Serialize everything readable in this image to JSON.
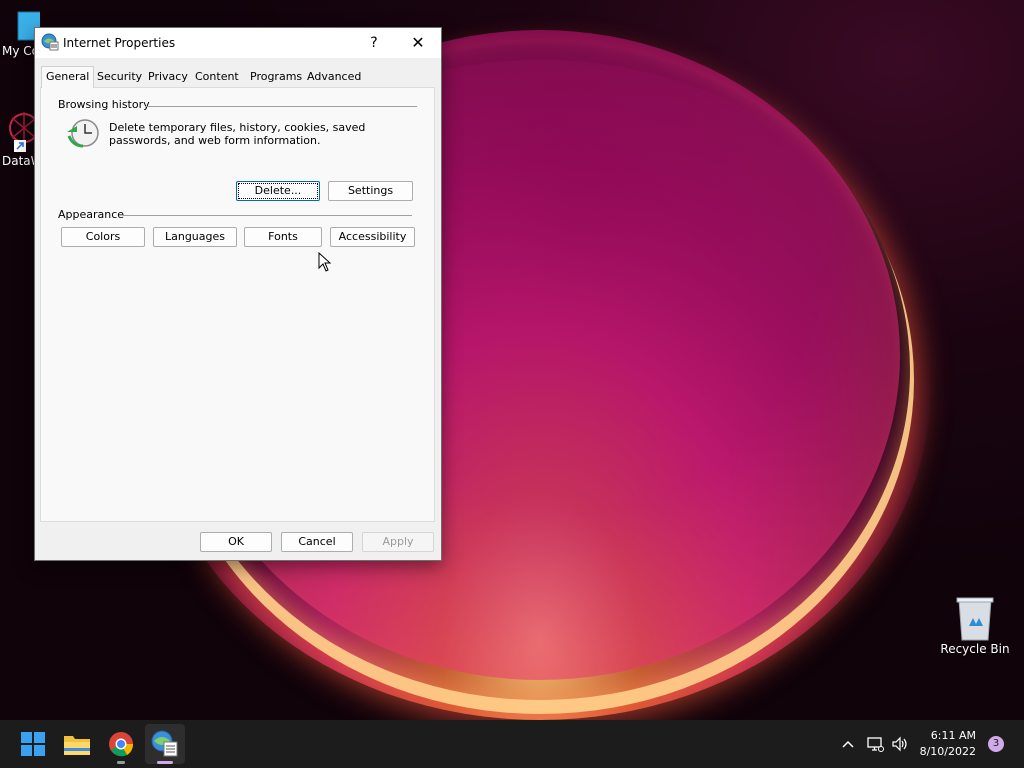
{
  "desktop": {
    "icons": [
      {
        "label": "My Co"
      },
      {
        "label": "DataW"
      },
      {
        "label": "Recycle Bin"
      }
    ]
  },
  "dialog": {
    "title": "Internet Properties",
    "help_label": "?",
    "close_label": "✕",
    "tabs": [
      {
        "label": "General",
        "active": true
      },
      {
        "label": "Security"
      },
      {
        "label": "Privacy"
      },
      {
        "label": "Content"
      },
      {
        "label": "Programs"
      },
      {
        "label": "Advanced"
      }
    ],
    "browsing_history": {
      "heading": "Browsing history",
      "description": "Delete temporary files, history, cookies, saved passwords, and web form information.",
      "delete_label": "Delete...",
      "settings_label": "Settings"
    },
    "appearance": {
      "heading": "Appearance",
      "buttons": [
        {
          "label": "Colors"
        },
        {
          "label": "Languages"
        },
        {
          "label": "Fonts"
        },
        {
          "label": "Accessibility"
        }
      ]
    },
    "footer": {
      "ok_label": "OK",
      "cancel_label": "Cancel",
      "apply_label": "Apply",
      "apply_disabled": true
    }
  },
  "taskbar": {
    "items": [
      {
        "icon": "windows-start-icon"
      },
      {
        "icon": "file-explorer-icon"
      },
      {
        "icon": "chrome-icon"
      },
      {
        "icon": "internet-properties-icon",
        "active": true
      }
    ],
    "tray": {
      "time": "6:11 AM",
      "date": "8/10/2022",
      "notification_count": "3"
    }
  },
  "colors": {
    "accent": "#0067c0",
    "taskbar": "#1c1c1c"
  }
}
